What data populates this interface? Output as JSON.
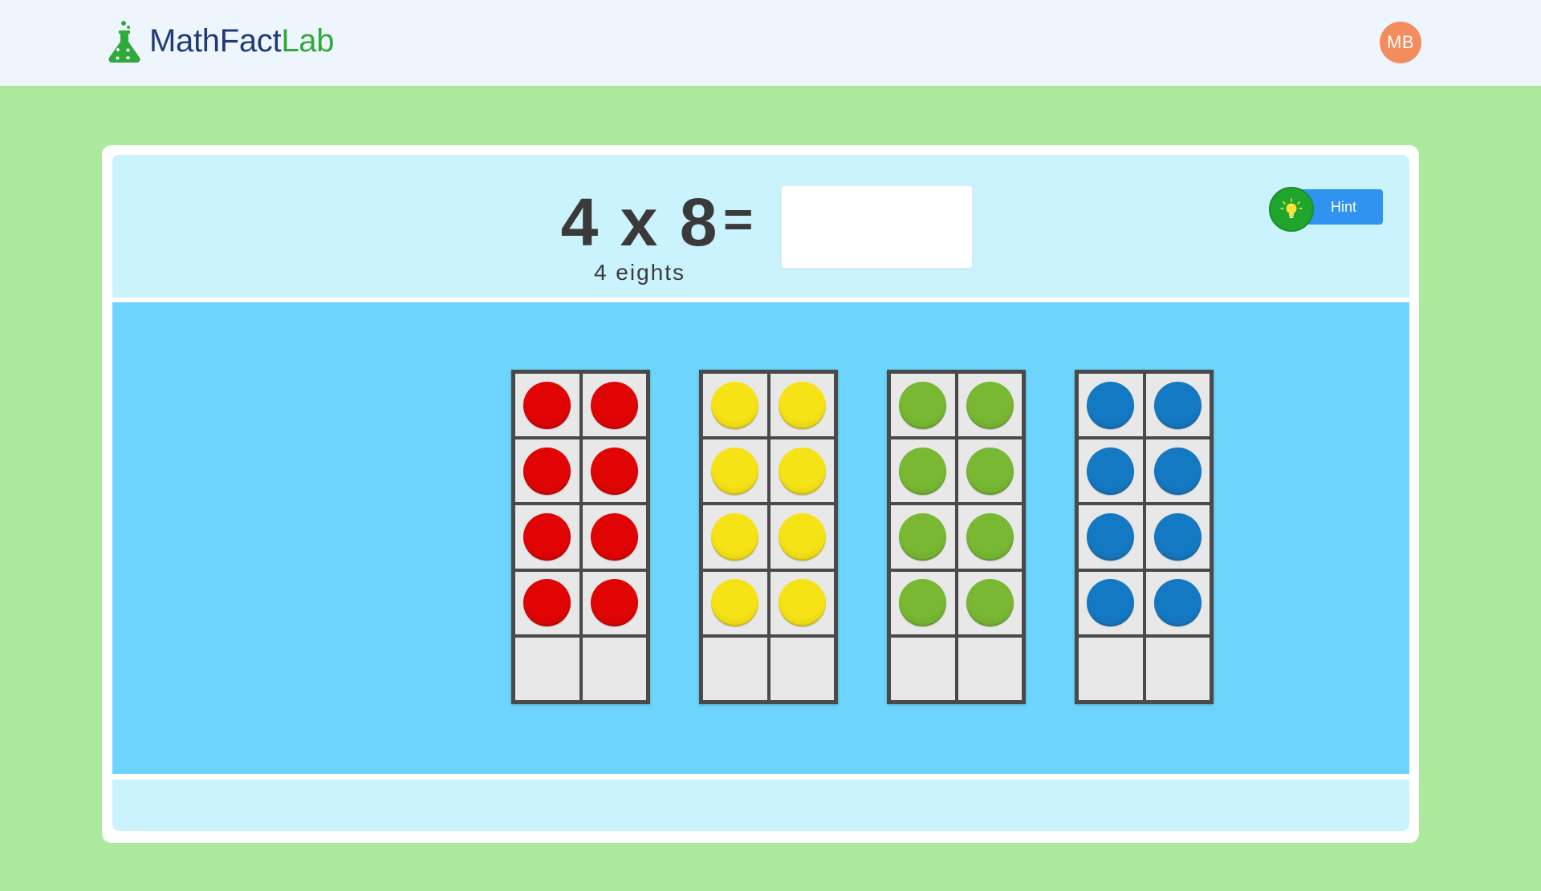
{
  "header": {
    "logo": {
      "part1": "MathFact",
      "part2": "Lab"
    },
    "avatar_initials": "MB"
  },
  "problem": {
    "factor_a": "4",
    "operator": "x",
    "factor_b": "8",
    "expression": "4 x 8",
    "equals": "=",
    "words": "4 eights",
    "answer_value": "",
    "answer_placeholder": ""
  },
  "hint": {
    "label": "Hint",
    "icon": "lightbulb-icon"
  },
  "ten_frames": [
    {
      "color_name": "red",
      "color": "#e00404",
      "filled": 8,
      "capacity": 10
    },
    {
      "color_name": "yellow",
      "color": "#f6e316",
      "filled": 8,
      "capacity": 10
    },
    {
      "color_name": "green",
      "color": "#78b832",
      "filled": 8,
      "capacity": 10
    },
    {
      "color_name": "blue",
      "color": "#1479c3",
      "filled": 8,
      "capacity": 10
    }
  ],
  "colors": {
    "background": "#ade99d",
    "header": "#eef5fd",
    "problem_panel": "#caf3fe",
    "model_panel": "#6dd5fd",
    "hint_button": "#2f93ef",
    "hint_bulb": "#1fa52c",
    "avatar": "#f38c5e"
  }
}
